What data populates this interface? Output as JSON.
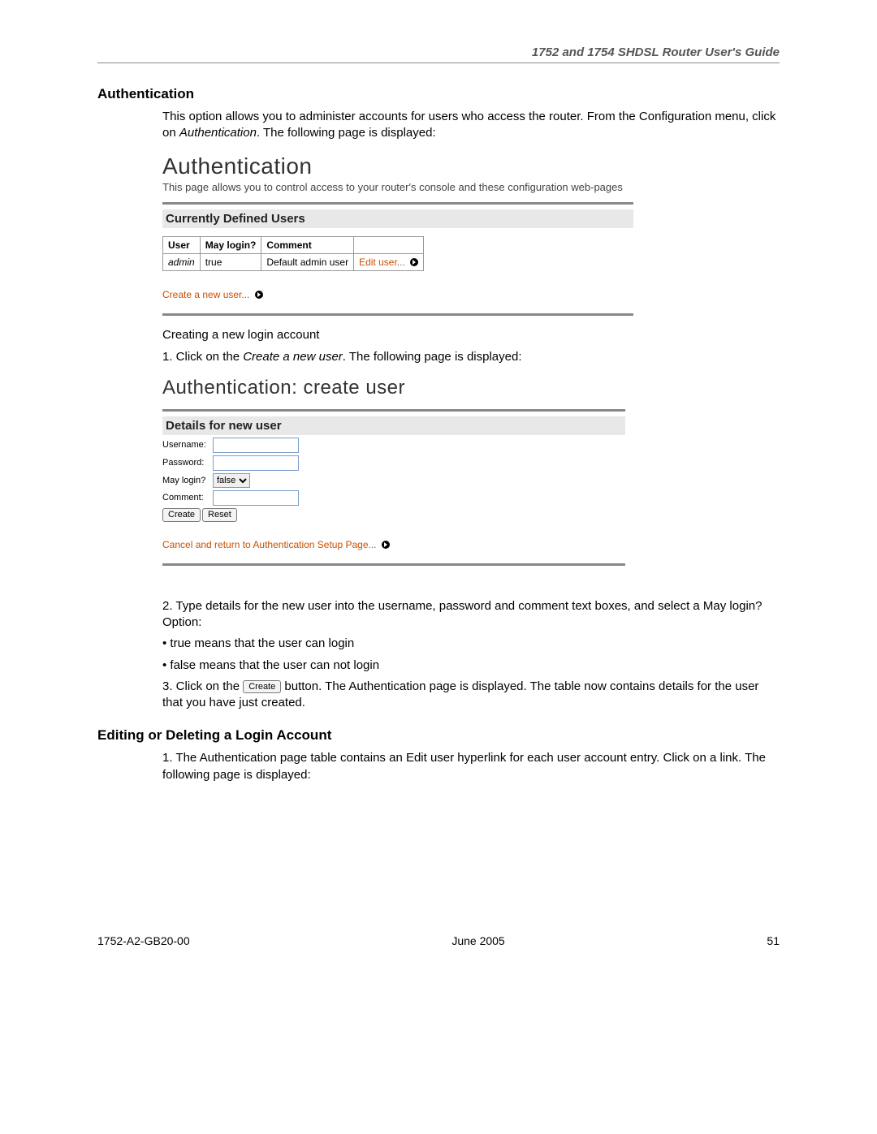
{
  "header": {
    "running": "1752 and 1754 SHDSL Router User's Guide"
  },
  "section1": {
    "title": "Authentication",
    "intro_a": "This option allows you to administer accounts for users who access the router. From the Configuration menu, click on ",
    "intro_b_ital": "Authentication",
    "intro_c": ". The following page is displayed:"
  },
  "shot1": {
    "h1": "Authentication",
    "sub": "This page allows you to control access to your router's console and these configuration web-pages",
    "panel": "Currently Defined Users",
    "cols": {
      "user": "User",
      "may": "May login?",
      "comment": "Comment"
    },
    "row": {
      "user": "admin",
      "may": "true",
      "comment": "Default admin user",
      "edit": "Edit user..."
    },
    "create_link": "Create a new user..."
  },
  "mid": {
    "creating": "Creating a new login account",
    "step1_a": "1. Click on the ",
    "step1_b_ital": "Create a new user",
    "step1_c": ". The following page is displayed:"
  },
  "shot2": {
    "h1": "Authentication: create user",
    "panel": "Details for new user",
    "labels": {
      "username": "Username:",
      "password": "Password:",
      "may": "May login?",
      "comment": "Comment:"
    },
    "may_value": "false",
    "btn_create": "Create",
    "btn_reset": "Reset",
    "cancel_link": "Cancel and return to Authentication Setup Page..."
  },
  "after": {
    "step2": "2. Type details for the new user into the username, password and comment text boxes, and select a May login? Option:",
    "bullet_true": "• true means that the user can login",
    "bullet_false": "• false means that the user can not login",
    "step3_a": "3. Click on the ",
    "step3_btn": "Create",
    "step3_b": " button. The Authentication page is displayed. The table now contains details for the user that you have just created."
  },
  "section2": {
    "title": "Editing or Deleting a Login Account",
    "step1": "1. The Authentication page table contains an Edit user hyperlink for each user account entry. Click on a link. The following page is displayed:"
  },
  "footer": {
    "left": "1752-A2-GB20-00",
    "center": "June 2005",
    "right": "51"
  }
}
